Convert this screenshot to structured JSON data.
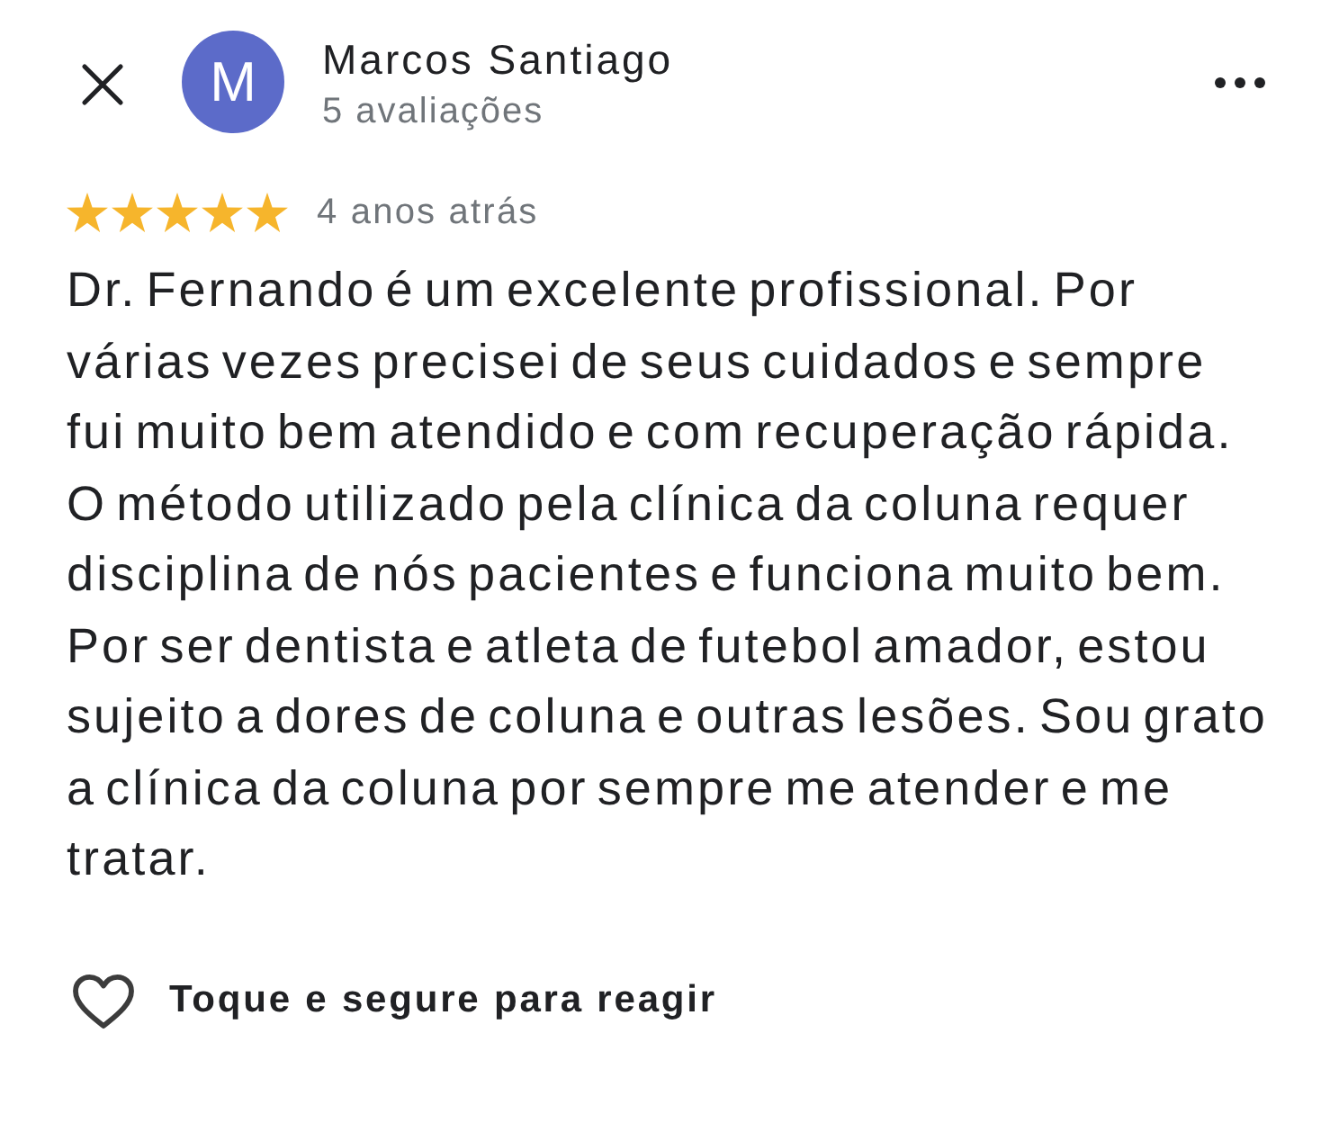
{
  "reviewer": {
    "avatar_letter": "M",
    "name": "Marcos Santiago",
    "review_count": "5 avaliações"
  },
  "rating": {
    "stars": 5,
    "time": "4 anos atrás"
  },
  "review_text": "Dr. Fernando é um excelente profissional. Por várias vezes precisei de seus cuidados e sempre fui muito bem atendido e com recuperação rápida. O método utilizado pela clínica da coluna requer disciplina de nós pacientes e funciona muito bem. Por ser dentista e atleta de futebol amador, estou sujeito a dores de coluna e outras lesões. Sou grato a clínica da coluna por sempre me atender e me tratar.",
  "reaction": {
    "label": "Toque e segure para reagir"
  }
}
